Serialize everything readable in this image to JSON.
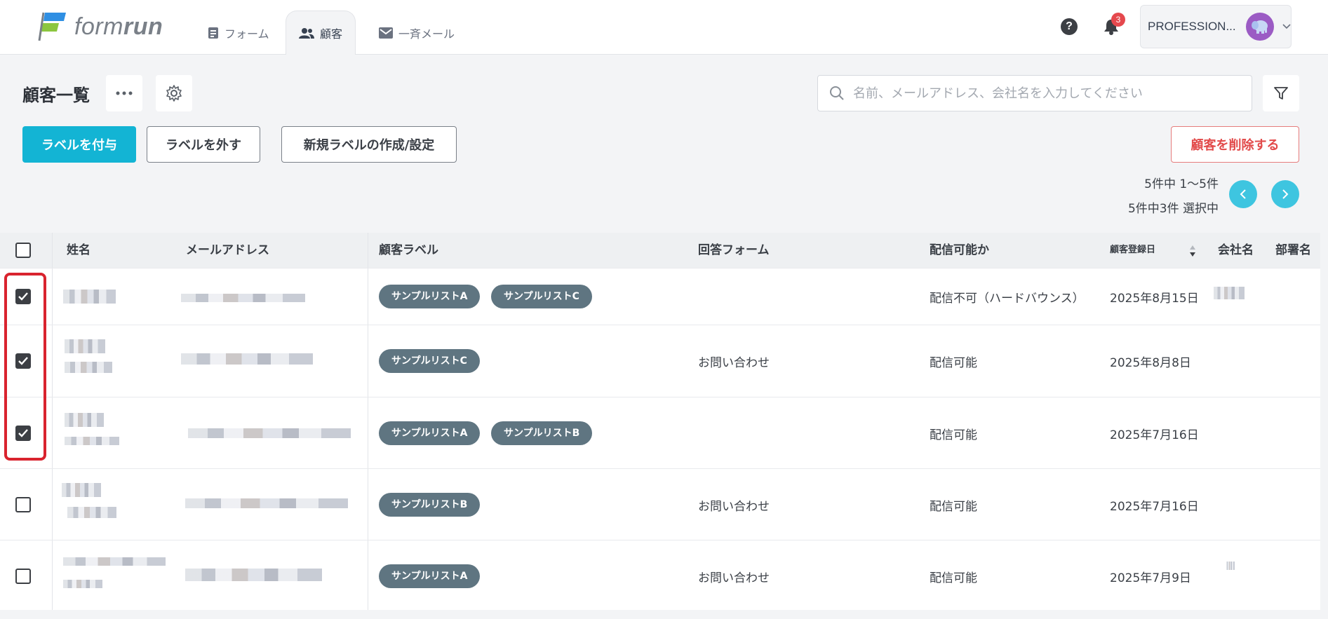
{
  "header": {
    "logo_text_light": "form",
    "logo_text_bold": "run",
    "tabs": [
      {
        "label": "フォーム",
        "icon": "form-icon",
        "active": false
      },
      {
        "label": "顧客",
        "icon": "people-icon",
        "active": true
      },
      {
        "label": "一斉メール",
        "icon": "mail-icon",
        "active": false
      }
    ],
    "help_label": "?",
    "notification_count": "3",
    "account_name": "PROFESSION..."
  },
  "toolbar": {
    "title": "顧客一覧",
    "search_placeholder": "名前、メールアドレス、会社名を入力してください",
    "buttons": {
      "add_label": "ラベルを付与",
      "remove_label": "ラベルを外す",
      "create_label": "新規ラベルの作成/設定",
      "delete_customer": "顧客を削除する"
    },
    "pager": {
      "range": "5件中 1〜5件",
      "selected": "5件中3件 選択中"
    }
  },
  "table": {
    "columns": [
      "姓名",
      "メールアドレス",
      "顧客ラベル",
      "回答フォーム",
      "配信可能か",
      "顧客登録日",
      "会社名",
      "部署名"
    ],
    "rows": [
      {
        "checked": true,
        "labels": [
          "サンプルリストA",
          "サンプルリストC"
        ],
        "form": "",
        "deliverable": "配信不可（ハードバウンス）",
        "date": "2025年8月15日"
      },
      {
        "checked": true,
        "labels": [
          "サンプルリストC"
        ],
        "form": "お問い合わせ",
        "deliverable": "配信可能",
        "date": "2025年8月8日"
      },
      {
        "checked": true,
        "labels": [
          "サンプルリストA",
          "サンプルリストB"
        ],
        "form": "",
        "deliverable": "配信可能",
        "date": "2025年7月16日"
      },
      {
        "checked": false,
        "labels": [
          "サンプルリストB"
        ],
        "form": "お問い合わせ",
        "deliverable": "配信可能",
        "date": "2025年7月16日"
      },
      {
        "checked": false,
        "labels": [
          "サンプルリストA"
        ],
        "form": "お問い合わせ",
        "deliverable": "配信可能",
        "date": "2025年7月9日"
      }
    ]
  },
  "colors": {
    "accent": "#13b4d4",
    "tag": "#5f7581",
    "danger": "#e24a4a",
    "highlight": "#d9232e"
  }
}
